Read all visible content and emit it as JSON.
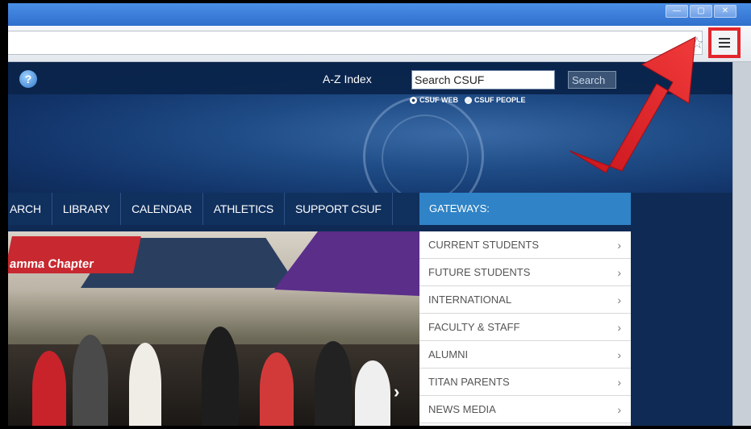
{
  "browser": {
    "window_buttons": [
      "—",
      "▢",
      "✕"
    ],
    "menu_button_highlight": "#e3262b"
  },
  "site": {
    "az_index": "A-Z Index",
    "search_value": "Search CSUF",
    "search_button": "Search",
    "radio_web": "CSUF WEB",
    "radio_people": "CSUF PEOPLE",
    "nav": [
      "ARCH",
      "LIBRARY",
      "CALENDAR",
      "ATHLETICS",
      "SUPPORT CSUF"
    ],
    "gateways_heading": "GATEWAYS:",
    "gateways": [
      "CURRENT STUDENTS",
      "FUTURE STUDENTS",
      "INTERNATIONAL",
      "FACULTY & STAFF",
      "ALUMNI",
      "TITAN PARENTS",
      "NEWS MEDIA"
    ],
    "photo_banner_text": "amma Chapter",
    "colors": {
      "navy": "#10305e",
      "gateways_blue": "#2f83c6",
      "annotation_red": "#e3262b"
    }
  }
}
